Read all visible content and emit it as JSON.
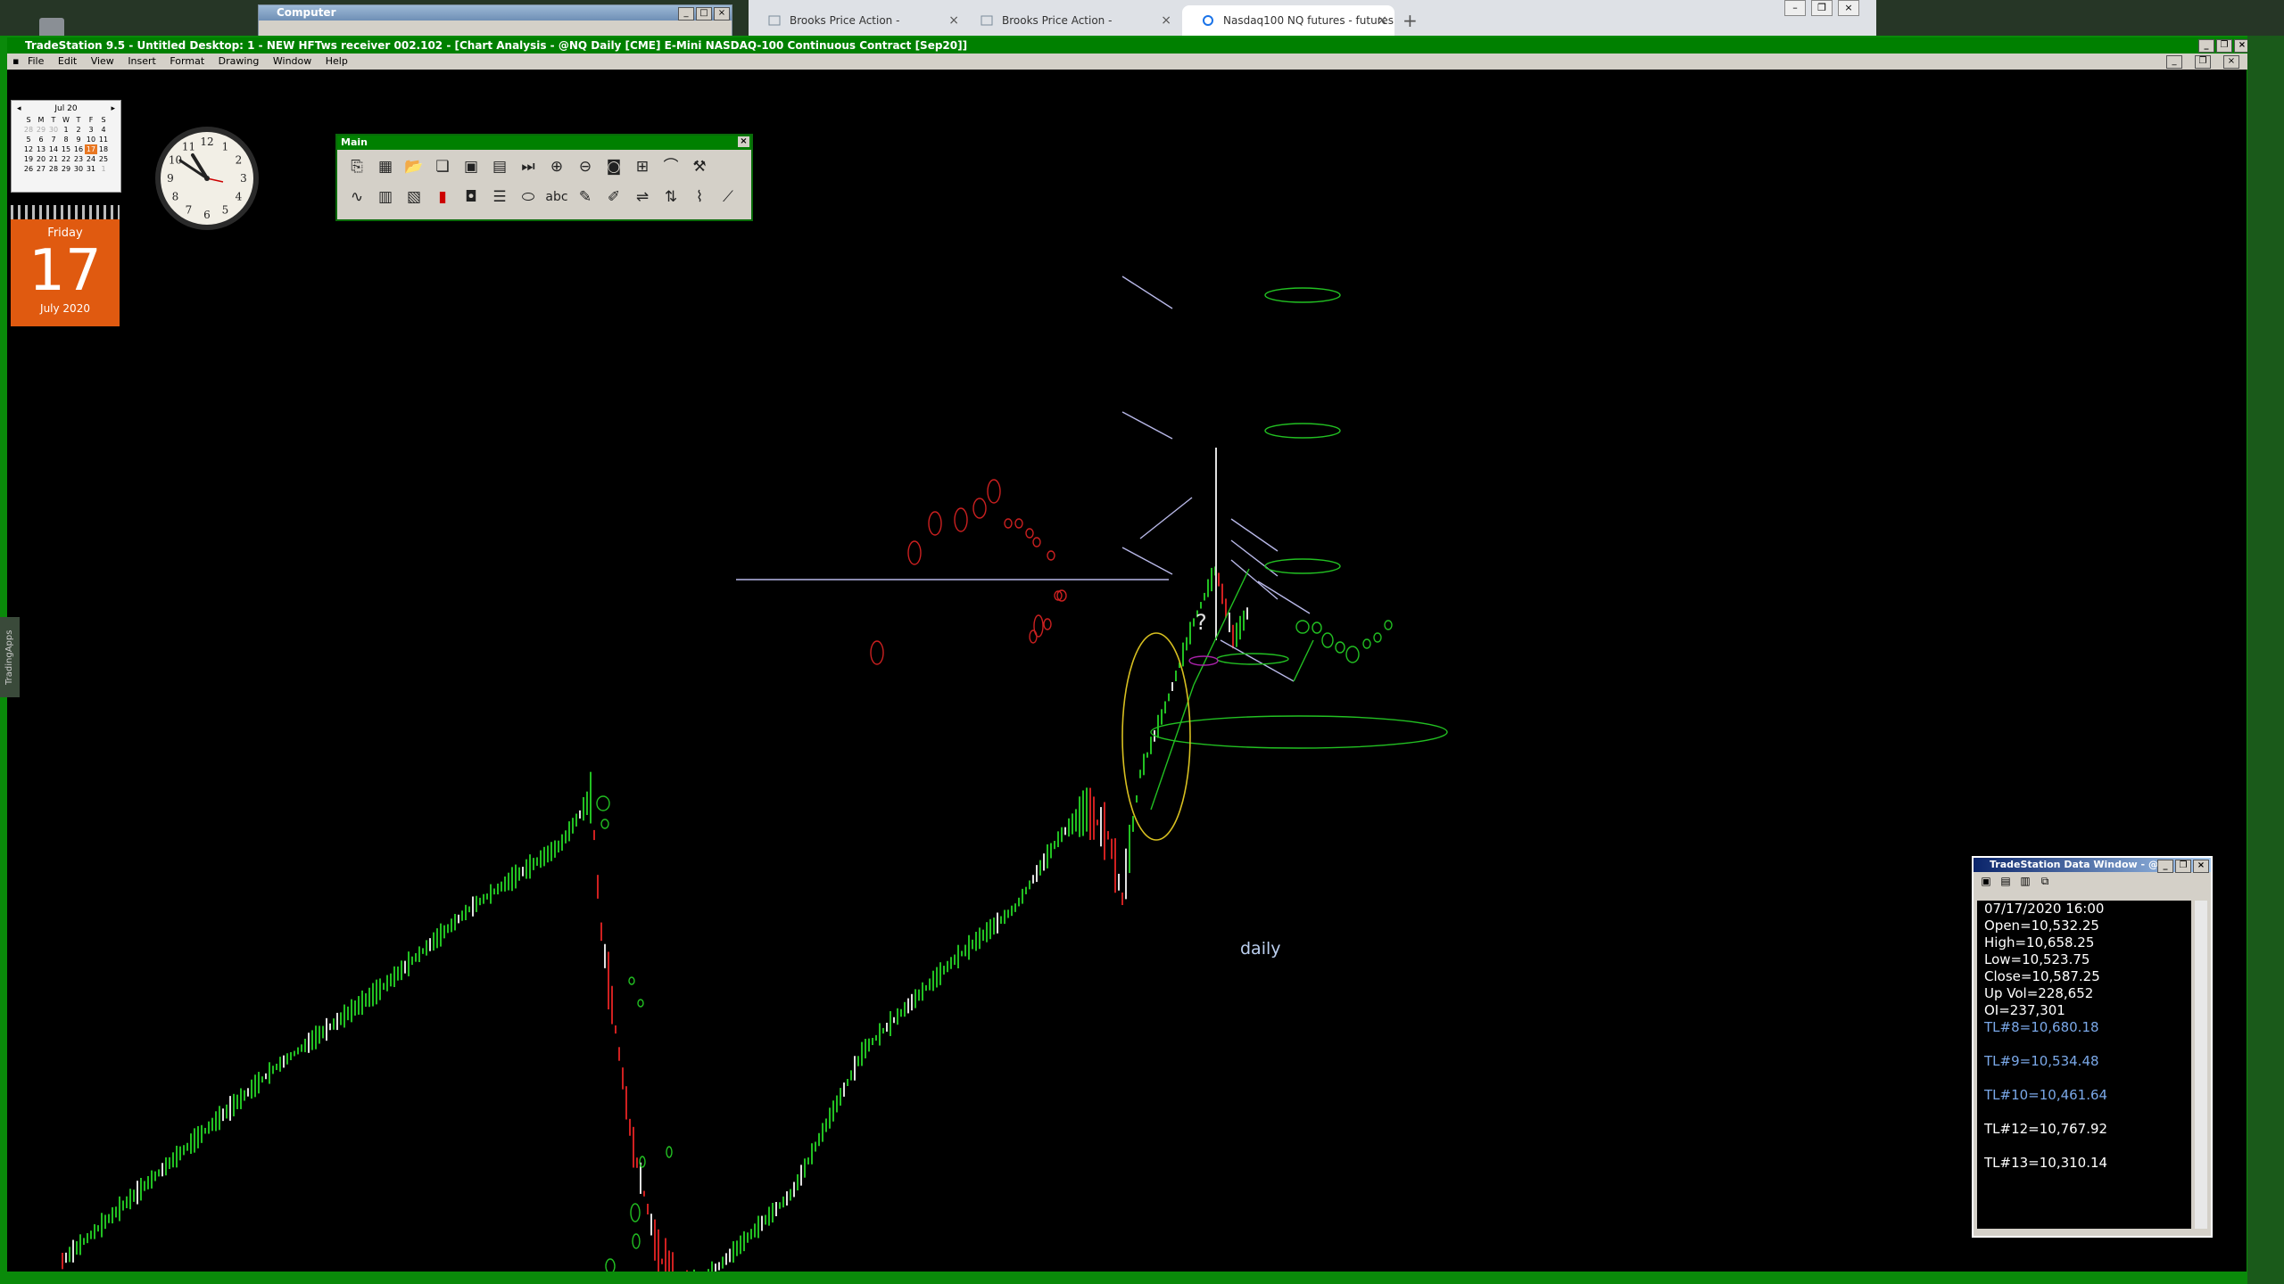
{
  "computer_window": {
    "title": "Computer"
  },
  "browser": {
    "tabs": [
      {
        "label": "Brooks Price Action -",
        "active": false
      },
      {
        "label": "Brooks Price Action -",
        "active": false
      },
      {
        "label": "Nasdaq100 NQ futures - futures",
        "active": true
      }
    ],
    "new_tab": "+"
  },
  "tradestation": {
    "title": "TradeStation 9.5 - Untitled Desktop: 1 - NEW HFTws receiver 002.102 - [Chart Analysis - @NQ Daily [CME] E-Mini NASDAQ-100 Continuous Contract [Sep20]]",
    "menu": [
      "File",
      "Edit",
      "View",
      "Insert",
      "Format",
      "Drawing",
      "Window",
      "Help"
    ]
  },
  "calendar": {
    "month": "Jul 20",
    "weekdays": [
      "S",
      "M",
      "T",
      "W",
      "T",
      "F",
      "S"
    ],
    "weeks": [
      [
        "28",
        "29",
        "30",
        "1",
        "2",
        "3",
        "4"
      ],
      [
        "5",
        "6",
        "7",
        "8",
        "9",
        "10",
        "11"
      ],
      [
        "12",
        "13",
        "14",
        "15",
        "16",
        "17",
        "18"
      ],
      [
        "19",
        "20",
        "21",
        "22",
        "23",
        "24",
        "25"
      ],
      [
        "26",
        "27",
        "28",
        "29",
        "30",
        "31",
        "1"
      ]
    ],
    "today": "17"
  },
  "datecard": {
    "weekday": "Friday",
    "day": "17",
    "month_year": "July 2020"
  },
  "clock": {
    "numbers": [
      "12",
      "1",
      "2",
      "3",
      "4",
      "5",
      "6",
      "7",
      "8",
      "9",
      "10",
      "11"
    ]
  },
  "toolbar": {
    "title": "Main",
    "row1": [
      "new-chart-icon",
      "tables-icon",
      "open-icon",
      "copy-icon",
      "save-icon",
      "print-icon",
      "play-end-icon",
      "zoom-in-icon",
      "zoom-out-icon",
      "color-icon",
      "insert-icon",
      "curve-icon",
      "tools-icon"
    ],
    "row2": [
      "indicator-icon",
      "strategy-icon",
      "grid-icon",
      "color-bar-icon",
      "camera-icon",
      "lines-icon",
      "ellipse-icon",
      "text-icon",
      "pencil-icon",
      "highlight-icon",
      "marker-icon",
      "arrows-icon",
      "cycle-icon",
      "fib-icon"
    ],
    "row2_text": "abc"
  },
  "chart": {
    "annotation": "daily",
    "question_mark": "?",
    "colors": {
      "up_bar": "#22c022",
      "down_bar": "#d02020",
      "flat_bar": "#e0e0e0",
      "ellipse_green": "#22c022",
      "ellipse_red": "#cc2020",
      "ellipse_yellow": "#d8c020",
      "trend_line": "#b8b8e8"
    }
  },
  "data_window": {
    "title": "TradeStation Data Window - @N",
    "rows": [
      {
        "text": "07/17/2020 16:00",
        "color": "#ffffff"
      },
      {
        "text": "Open=10,532.25",
        "color": "#ffffff"
      },
      {
        "text": "High=10,658.25",
        "color": "#ffffff"
      },
      {
        "text": "Low=10,523.75",
        "color": "#ffffff"
      },
      {
        "text": "Close=10,587.25",
        "color": "#ffffff"
      },
      {
        "text": "Up Vol=228,652",
        "color": "#ffffff"
      },
      {
        "text": "OI=237,301",
        "color": "#ffffff"
      },
      {
        "text": "TL#8=10,680.18",
        "color": "#7aa8e8"
      },
      {
        "text": "",
        "color": "#ffffff"
      },
      {
        "text": "TL#9=10,534.48",
        "color": "#7aa8e8"
      },
      {
        "text": "",
        "color": "#ffffff"
      },
      {
        "text": "TL#10=10,461.64",
        "color": "#7aa8e8"
      },
      {
        "text": "",
        "color": "#ffffff"
      },
      {
        "text": "TL#12=10,767.92",
        "color": "#ffffff"
      },
      {
        "text": "",
        "color": "#ffffff"
      },
      {
        "text": "TL#13=10,310.14",
        "color": "#ffffff"
      }
    ]
  },
  "side_tab": "TradingApps"
}
